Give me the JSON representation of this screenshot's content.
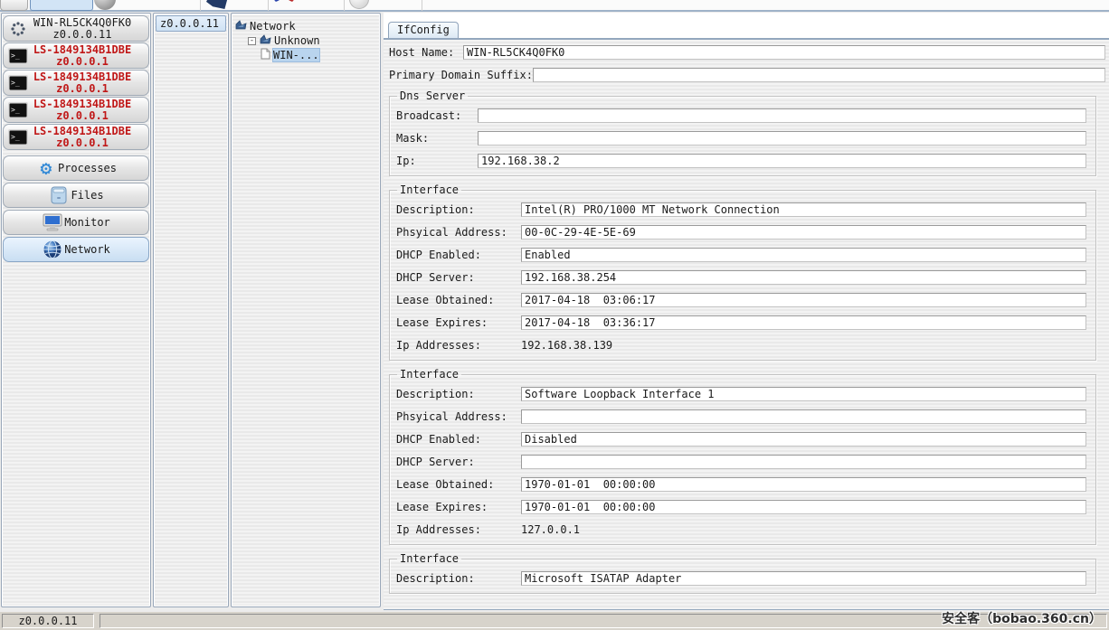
{
  "toolbar": {
    "icons": [
      "ghost-button",
      "pressed-tab-button",
      "grey-sphere-icon",
      "flag-icon",
      "tools-icon",
      "light-sphere-icon"
    ]
  },
  "sidebar": {
    "hosts": [
      {
        "name": "WIN-RL5CK4Q0FK0",
        "ip": "z0.0.0.11",
        "icon": "spinner-icon",
        "red": false
      },
      {
        "name": "LS-1849134B1DBE",
        "ip": "z0.0.0.1",
        "icon": "terminal-icon",
        "red": true
      },
      {
        "name": "LS-1849134B1DBE",
        "ip": "z0.0.0.1",
        "icon": "terminal-icon",
        "red": true
      },
      {
        "name": "LS-1849134B1DBE",
        "ip": "z0.0.0.1",
        "icon": "terminal-icon",
        "red": true
      },
      {
        "name": "LS-1849134B1DBE",
        "ip": "z0.0.0.1",
        "icon": "terminal-icon",
        "red": true
      }
    ],
    "tools": [
      {
        "label": "Processes",
        "icon": "gear-icon",
        "selected": false
      },
      {
        "label": "Files",
        "icon": "files-icon",
        "selected": false
      },
      {
        "label": "Monitor",
        "icon": "monitor-icon",
        "selected": false
      },
      {
        "label": "Network",
        "icon": "globe-icon",
        "selected": true
      }
    ],
    "accent_red": "#c01818",
    "selected_blue": "#c9def2"
  },
  "host_list": {
    "items": [
      {
        "label": "z0.0.0.11",
        "selected": true
      }
    ]
  },
  "tree": {
    "items": [
      {
        "label": "Network",
        "level": 0,
        "expander": "",
        "icon": "network-node-icon",
        "selected": false
      },
      {
        "label": "Unknown",
        "level": 1,
        "expander": "-",
        "icon": "network-node-icon",
        "selected": false
      },
      {
        "label": "WIN-...",
        "level": 2,
        "expander": "",
        "icon": "document-icon",
        "selected": true
      }
    ]
  },
  "main": {
    "tab_label": "IfConfig",
    "host_name": {
      "label": "Host Name:",
      "value": "WIN-RL5CK4Q0FK0"
    },
    "primary_domain_suffix": {
      "label": "Primary Domain Suffix:",
      "value": ""
    },
    "groups": [
      {
        "title": "Dns Server",
        "rows": [
          {
            "label": "Broadcast:",
            "value": "",
            "boxed": true
          },
          {
            "label": "Mask:",
            "value": "",
            "boxed": true
          },
          {
            "label": "Ip:",
            "value": "192.168.38.2",
            "boxed": true
          }
        ]
      },
      {
        "title": "Interface",
        "rows": [
          {
            "label": "Description:",
            "value": "Intel(R) PRO/1000 MT Network Connection",
            "boxed": true
          },
          {
            "label": "Phsyical Address:",
            "value": "00-0C-29-4E-5E-69",
            "boxed": true
          },
          {
            "label": "DHCP Enabled:",
            "value": "Enabled",
            "boxed": true
          },
          {
            "label": "DHCP Server:",
            "value": "192.168.38.254",
            "boxed": true
          },
          {
            "label": "Lease Obtained:",
            "value": "2017-04-18  03:06:17",
            "boxed": true
          },
          {
            "label": "Lease Expires:",
            "value": "2017-04-18  03:36:17",
            "boxed": true
          },
          {
            "label": "Ip Addresses:",
            "value": "192.168.38.139",
            "boxed": false
          }
        ]
      },
      {
        "title": "Interface",
        "rows": [
          {
            "label": "Description:",
            "value": "Software Loopback Interface 1",
            "boxed": true
          },
          {
            "label": "Phsyical Address:",
            "value": "",
            "boxed": true
          },
          {
            "label": "DHCP Enabled:",
            "value": "Disabled",
            "boxed": true
          },
          {
            "label": "DHCP Server:",
            "value": "",
            "boxed": true
          },
          {
            "label": "Lease Obtained:",
            "value": "1970-01-01  00:00:00",
            "boxed": true
          },
          {
            "label": "Lease Expires:",
            "value": "1970-01-01  00:00:00",
            "boxed": true
          },
          {
            "label": "Ip Addresses:",
            "value": "127.0.0.1",
            "boxed": false
          }
        ]
      },
      {
        "title": "Interface",
        "rows": [
          {
            "label": "Description:",
            "value": "Microsoft ISATAP Adapter",
            "boxed": true
          }
        ]
      }
    ]
  },
  "statusbar": {
    "left": "z0.0.0.11",
    "watermark": "安全客（bobao.360.cn）"
  }
}
